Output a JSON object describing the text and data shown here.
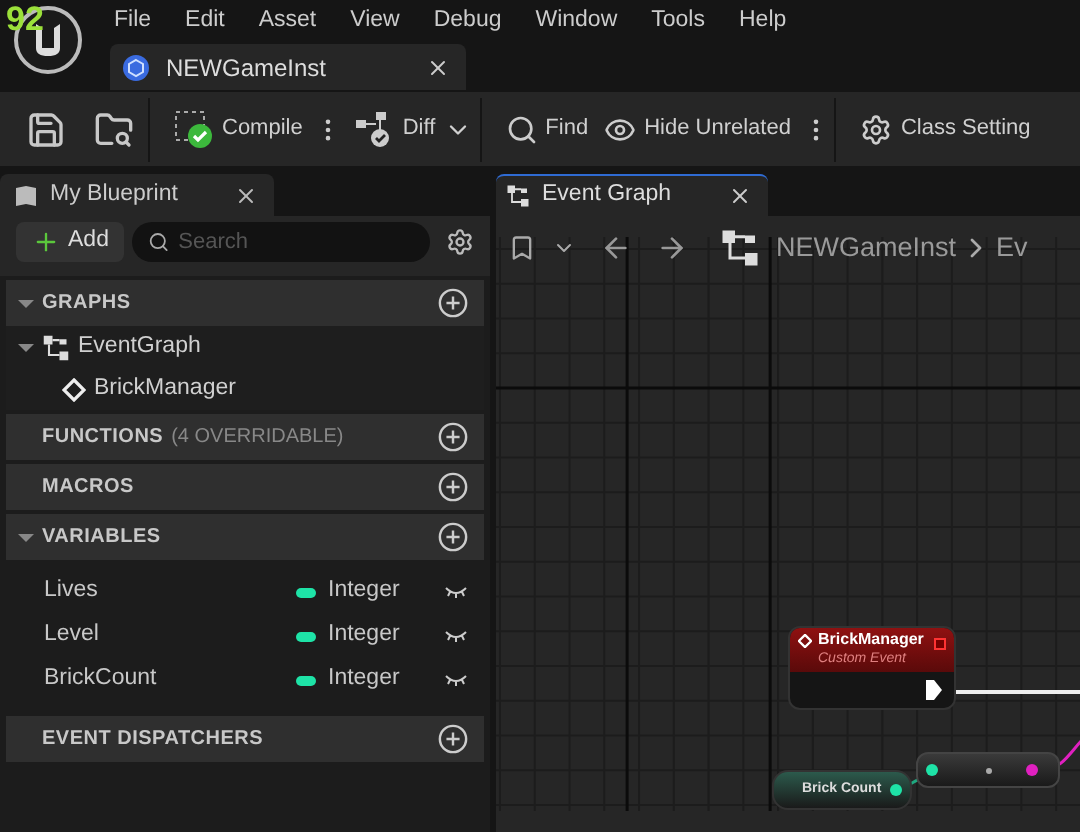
{
  "overlay_text": "92",
  "menu": [
    "File",
    "Edit",
    "Asset",
    "View",
    "Debug",
    "Window",
    "Tools",
    "Help"
  ],
  "document_tab": {
    "title": "NEWGameInst"
  },
  "toolbar": [
    {
      "kind": "save"
    },
    {
      "kind": "browse"
    },
    {
      "kind": "compile",
      "label": "Compile"
    },
    {
      "kind": "diff",
      "label": "Diff"
    },
    {
      "kind": "find",
      "label": "Find"
    },
    {
      "kind": "hide",
      "label": "Hide Unrelated"
    },
    {
      "kind": "settings",
      "label": "Class Setting"
    }
  ],
  "my_blueprint": {
    "title": "My Blueprint",
    "add_label": "Add",
    "search": {
      "placeholder": "Search"
    },
    "sections": [
      {
        "title": "GRAPHS",
        "expanded": true,
        "items": [
          {
            "kind": "graph",
            "label": "EventGraph",
            "expanded": true,
            "children": [
              {
                "kind": "event",
                "label": "BrickManager"
              }
            ]
          }
        ]
      },
      {
        "title": "FUNCTIONS",
        "note": "(4 OVERRIDABLE)",
        "expanded": false
      },
      {
        "title": "MACROS",
        "expanded": false
      },
      {
        "title": "VARIABLES",
        "expanded": true,
        "items": [
          {
            "kind": "variable",
            "label": "Lives",
            "type": "Integer",
            "color": "#1ee3a7"
          },
          {
            "kind": "variable",
            "label": "Level",
            "type": "Integer",
            "color": "#1ee3a7"
          },
          {
            "kind": "variable",
            "label": "BrickCount",
            "type": "Integer",
            "color": "#1ee3a7"
          }
        ]
      },
      {
        "title": "EVENT DISPATCHERS",
        "expanded": false
      }
    ]
  },
  "graph_tab": {
    "title": "Event Graph"
  },
  "breadcrumb": [
    "NEWGameInst",
    "Ev"
  ],
  "nodes": {
    "event": {
      "title": "BrickManager",
      "subtitle": "Custom Event"
    },
    "getter": {
      "label": "Brick Count"
    }
  }
}
